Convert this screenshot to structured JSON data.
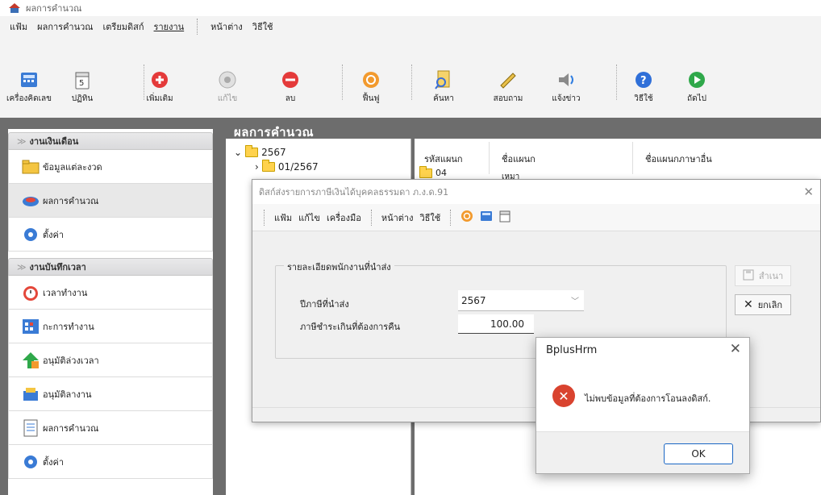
{
  "window": {
    "title": "ผลการคำนวณ"
  },
  "menubar": {
    "items": [
      "แฟ้ม",
      "ผลการคำนวณ",
      "เตรียมดิสก์",
      "รายงาน"
    ],
    "items2": [
      "หน้าต่าง",
      "วิธีใช้"
    ]
  },
  "toolbar": {
    "calculator": "เครื่องคิดเลข",
    "calendar": "ปฏิทิน",
    "add": "เพิ่มเติม",
    "edit": "แก้ไข",
    "delete": "ลบ",
    "restore": "ฟื้นฟู",
    "search": "ค้นหา",
    "inquire": "สอบถาม",
    "notify": "แจ้งข่าว",
    "help": "วิธีใช้",
    "next": "ถัดไป"
  },
  "sidebar": {
    "section1": "งานเงินเดือน",
    "items1": [
      "ข้อมูลแต่ละงวด",
      "ผลการคำนวณ",
      "ตั้งค่า"
    ],
    "section2": "งานบันทึกเวลา",
    "items2": [
      "เวลาทำงาน",
      "กะการทำงาน",
      "อนุมัติล่วงเวลา",
      "อนุมัติลางาน",
      "ผลการคำนวณ",
      "ตั้งค่า"
    ]
  },
  "content": {
    "title": "ผลการคำนวณ",
    "tree": {
      "year": "2567",
      "period": "01/2567"
    },
    "grid": {
      "columns": [
        "รหัสแผนก",
        "ชื่อแผนก",
        "ชื่อแผนกภาษาอื่น"
      ],
      "row": {
        "code": "04",
        "name": "เหมา"
      }
    }
  },
  "dialog": {
    "title": "ดิสก์ส่งรายการภาษีเงินได้บุคคลธรรมดา ภ.ง.ด.91",
    "menu": [
      "แฟ้ม",
      "แก้ไข",
      "เครื่องมือ"
    ],
    "menu2": [
      "หน้าต่าง",
      "วิธีใช้"
    ],
    "group_title": "รายละเอียดพนักงานที่นำส่ง",
    "year_label": "ปีภาษีที่นำส่ง",
    "year_value": "2567",
    "refund_label": "ภาษีชำระเกินที่ต้องการคืน",
    "refund_value": "100.00",
    "copy_button": "สำเนา",
    "cancel_button": "ยกเลิก"
  },
  "msgbox": {
    "title": "BplusHrm",
    "message": "ไม่พบข้อมูลที่ต้องการโอนลงดิสก์.",
    "ok": "OK"
  },
  "colors": {
    "main_bg": "#6d6d6d",
    "error_red": "#d9432f",
    "ok_border": "#1a66c4"
  }
}
